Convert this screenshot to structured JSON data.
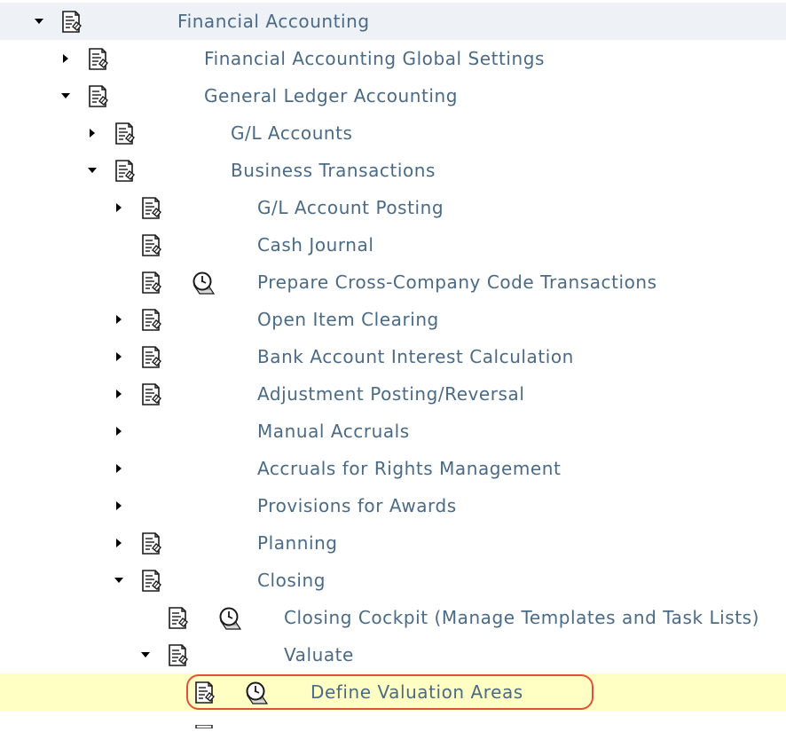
{
  "tree": {
    "nodes": [
      {
        "id": "fa",
        "label": "Financial Accounting",
        "toggle": "expanded",
        "doc": true,
        "clock": false
      },
      {
        "id": "fa-global",
        "label": "Financial Accounting Global Settings",
        "toggle": "collapsed",
        "doc": true,
        "clock": false
      },
      {
        "id": "gl-acc",
        "label": "General Ledger Accounting",
        "toggle": "expanded",
        "doc": true,
        "clock": false
      },
      {
        "id": "gl-accounts",
        "label": "G/L Accounts",
        "toggle": "collapsed",
        "doc": true,
        "clock": false
      },
      {
        "id": "bus-trans",
        "label": "Business Transactions",
        "toggle": "expanded",
        "doc": true,
        "clock": false
      },
      {
        "id": "gl-posting",
        "label": "G/L Account Posting",
        "toggle": "collapsed",
        "doc": true,
        "clock": false
      },
      {
        "id": "cash-journal",
        "label": "Cash Journal",
        "toggle": "none",
        "doc": true,
        "clock": false
      },
      {
        "id": "cross-company",
        "label": "Prepare Cross-Company Code Transactions",
        "toggle": "none",
        "doc": true,
        "clock": true
      },
      {
        "id": "open-item",
        "label": "Open Item Clearing",
        "toggle": "collapsed",
        "doc": true,
        "clock": false
      },
      {
        "id": "bank-interest",
        "label": "Bank Account Interest Calculation",
        "toggle": "collapsed",
        "doc": true,
        "clock": false
      },
      {
        "id": "adj-posting",
        "label": "Adjustment Posting/Reversal",
        "toggle": "collapsed",
        "doc": true,
        "clock": false
      },
      {
        "id": "manual-accruals",
        "label": "Manual Accruals",
        "toggle": "collapsed",
        "doc": false,
        "clock": false
      },
      {
        "id": "accr-rights",
        "label": "Accruals for Rights Management",
        "toggle": "collapsed",
        "doc": false,
        "clock": false
      },
      {
        "id": "provisions",
        "label": "Provisions for Awards",
        "toggle": "collapsed",
        "doc": false,
        "clock": false
      },
      {
        "id": "planning",
        "label": "Planning",
        "toggle": "collapsed",
        "doc": true,
        "clock": false
      },
      {
        "id": "closing",
        "label": "Closing",
        "toggle": "expanded",
        "doc": true,
        "clock": false
      },
      {
        "id": "closing-cockpit",
        "label": "Closing Cockpit (Manage Templates and Task Lists)",
        "toggle": "none",
        "doc": true,
        "clock": true
      },
      {
        "id": "valuate",
        "label": "Valuate",
        "toggle": "expanded",
        "doc": true,
        "clock": false
      },
      {
        "id": "define-val-areas",
        "label": "Define Valuation Areas",
        "toggle": "none",
        "doc": true,
        "clock": true,
        "selected": true
      }
    ]
  },
  "colors": {
    "label": "#4a6a86",
    "first_row_bg": "#eef2f7",
    "selected_bg": "#ffffc4",
    "highlight_ring": "#e0513a"
  },
  "icons": {
    "toggle_expanded": "triangle-down-icon",
    "toggle_collapsed": "triangle-right-icon",
    "doc": "document-icon",
    "clock": "clock-icon"
  }
}
